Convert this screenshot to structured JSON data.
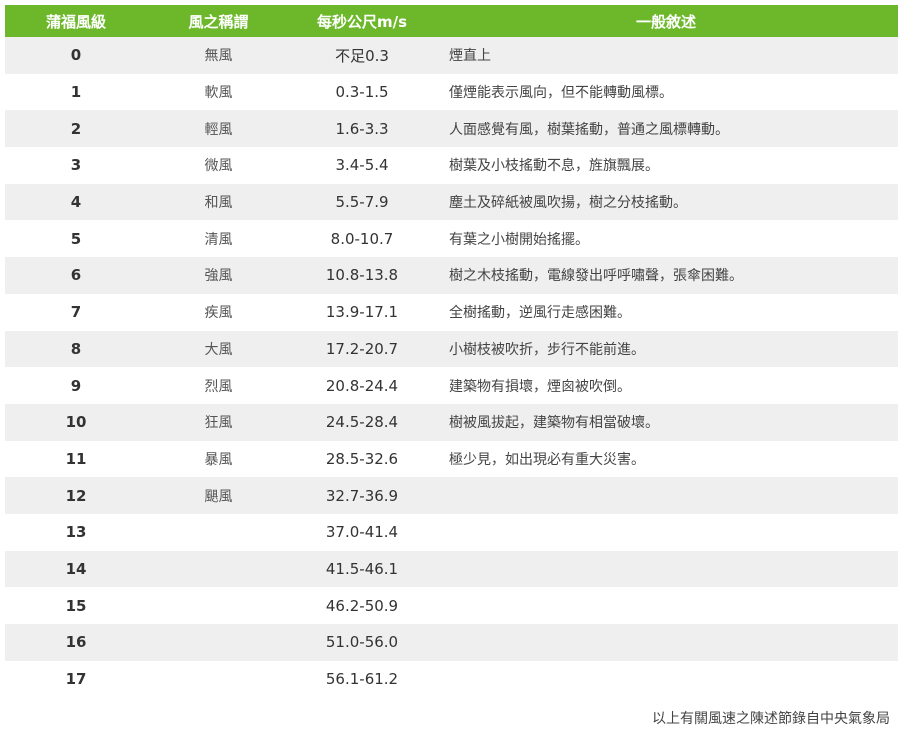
{
  "header": {
    "level": "蒲福風級",
    "name": "風之稱謂",
    "speed": "每秒公尺m/s",
    "description": "一般敘述"
  },
  "rows": [
    {
      "level": "0",
      "name": "無風",
      "speed": "不足0.3",
      "description": "煙直上"
    },
    {
      "level": "1",
      "name": "軟風",
      "speed": "0.3-1.5",
      "description": "僅煙能表示風向，但不能轉動風標。"
    },
    {
      "level": "2",
      "name": "輕風",
      "speed": "1.6-3.3",
      "description": "人面感覺有風，樹葉搖動，普通之風標轉動。"
    },
    {
      "level": "3",
      "name": "微風",
      "speed": "3.4-5.4",
      "description": "樹葉及小枝搖動不息，旌旗飄展。"
    },
    {
      "level": "4",
      "name": "和風",
      "speed": "5.5-7.9",
      "description": "塵土及碎紙被風吹揚，樹之分枝搖動。"
    },
    {
      "level": "5",
      "name": "清風",
      "speed": "8.0-10.7",
      "description": "有葉之小樹開始搖擺。"
    },
    {
      "level": "6",
      "name": "強風",
      "speed": "10.8-13.8",
      "description": "樹之木枝搖動，電線發出呼呼嘯聲，張傘困難。"
    },
    {
      "level": "7",
      "name": "疾風",
      "speed": "13.9-17.1",
      "description": "全樹搖動，逆風行走感困難。"
    },
    {
      "level": "8",
      "name": "大風",
      "speed": "17.2-20.7",
      "description": "小樹枝被吹折，步行不能前進。"
    },
    {
      "level": "9",
      "name": "烈風",
      "speed": "20.8-24.4",
      "description": "建築物有損壞，煙囪被吹倒。"
    },
    {
      "level": "10",
      "name": "狂風",
      "speed": "24.5-28.4",
      "description": "樹被風拔起，建築物有相當破壞。"
    },
    {
      "level": "11",
      "name": "暴風",
      "speed": "28.5-32.6",
      "description": "極少見，如出現必有重大災害。"
    },
    {
      "level": "12",
      "name": "颶風",
      "speed": "32.7-36.9",
      "description": ""
    },
    {
      "level": "13",
      "name": "",
      "speed": "37.0-41.4",
      "description": ""
    },
    {
      "level": "14",
      "name": "",
      "speed": "41.5-46.1",
      "description": ""
    },
    {
      "level": "15",
      "name": "",
      "speed": "46.2-50.9",
      "description": ""
    },
    {
      "level": "16",
      "name": "",
      "speed": "51.0-56.0",
      "description": ""
    },
    {
      "level": "17",
      "name": "",
      "speed": "56.1-61.2",
      "description": ""
    }
  ],
  "footer": {
    "source_note": "以上有關風速之陳述節錄自中央氣象局"
  }
}
